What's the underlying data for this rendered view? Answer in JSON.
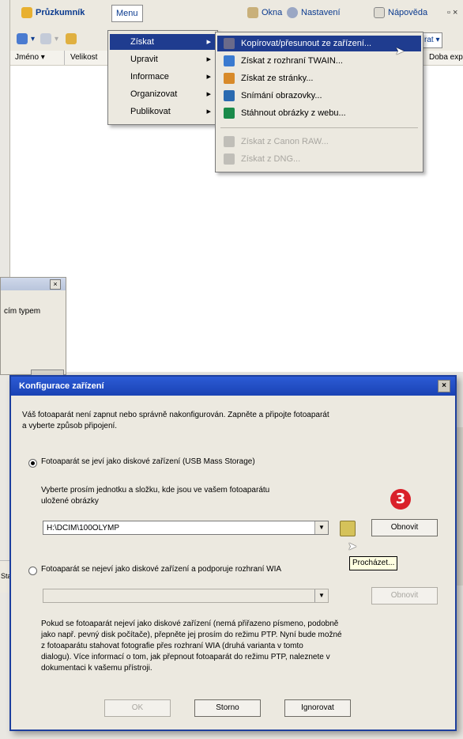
{
  "explorer": {
    "app_label": "Průzkumník",
    "menu_label": "Menu",
    "okna_label": "Okna",
    "nastaveni_label": "Nastavení",
    "napoveda_label": "Nápověda",
    "close_label": "▫ ×",
    "columns": [
      "Jméno",
      "Velikost",
      "Doba exp"
    ],
    "toolbar_right": "rat"
  },
  "menu": {
    "items": [
      {
        "label": "Získat",
        "has_submenu": true
      },
      {
        "label": "Upravit",
        "has_submenu": true
      },
      {
        "label": "Informace",
        "has_submenu": true
      },
      {
        "label": "Organizovat",
        "has_submenu": true
      },
      {
        "label": "Publikovat",
        "has_submenu": true
      }
    ]
  },
  "submenu": {
    "items": [
      {
        "label": "Kopírovat/přesunout ze zařízení...",
        "icon": "camera-icon",
        "icon_color": "#6a6a8a",
        "state": "selected"
      },
      {
        "label": "Získat z rozhraní TWAIN...",
        "icon": "scanner-icon",
        "icon_color": "#3a7ad0",
        "state": "normal"
      },
      {
        "label": "Získat ze stránky...",
        "icon": "page-icon",
        "icon_color": "#d88a2a",
        "state": "normal"
      },
      {
        "label": "Snímání obrazovky...",
        "icon": "screen-icon",
        "icon_color": "#2a6ab0",
        "state": "normal"
      },
      {
        "label": "Stáhnout obrázky z webu...",
        "icon": "globe-icon",
        "icon_color": "#1a8a4a",
        "state": "normal"
      },
      {
        "label": "Získat z Canon RAW...",
        "icon": "raw-icon",
        "icon_color": "#c0beb8",
        "state": "disabled"
      },
      {
        "label": "Získat z DNG...",
        "icon": "dng-icon",
        "icon_color": "#c0beb8",
        "state": "disabled"
      }
    ]
  },
  "small_dialog": {
    "close": "×",
    "text": "cím typem"
  },
  "dialog": {
    "title": "Konfigurace zařízení",
    "close": "×",
    "intro_line1": "Váš fotoaparát není zapnut nebo správně nakonfigurován. Zapněte a připojte fotoaparát",
    "intro_line2": "a vyberte způsob připojení.",
    "option1": "Fotoaparát se jeví jako diskové zařízení (USB Mass Storage)",
    "option1_hint_line1": "Vyberte prosím jednotku a složku, kde jsou ve vašem fotoaparátu",
    "option1_hint_line2": "uložené obrázky",
    "path_value": "H:\\DCIM\\100OLYMP",
    "refresh_label": "Obnovit",
    "browse_tooltip": "Procházet...",
    "option2": "Fotoaparát se nejeví jako diskové zařízení a podporuje rozhraní WIA",
    "refresh2_label": "Obnovit",
    "info_lines": [
      "Pokud se fotoaparát nejeví jako diskové zařízení (nemá přiřazeno písmeno, podobně",
      "jako např. pevný disk počítače), přepněte jej prosím do režimu PTP. Nyní bude možné",
      "z fotoaparátu stahovat fotografie přes rozhraní WIA (druhá varianta v tomto",
      "dialogu). Více informací o tom, jak přepnout fotoaparát do režimu PTP, naleznete v",
      "dokumentaci k vašemu přístroji."
    ],
    "ok_label": "OK",
    "cancel_label": "Storno",
    "ignore_label": "Ignorovat"
  },
  "step_badge": "3",
  "left_fragment": "Sta"
}
